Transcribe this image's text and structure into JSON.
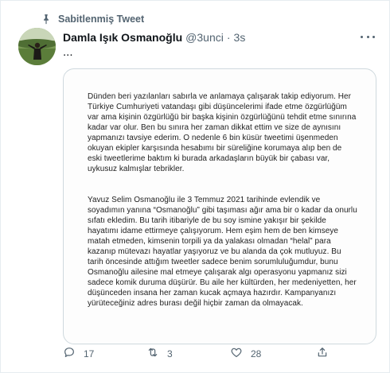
{
  "pinned": {
    "label": "Sabitlenmiş Tweet"
  },
  "author": {
    "name": "Damla Işık Osmanoğlu",
    "handle": "@3unci",
    "separator": "·",
    "time": "3s"
  },
  "tweet": {
    "text": "...",
    "image_paragraphs": [
      "Dünden beri yazılanları sabırla ve anlamaya çalışarak takip ediyorum. Her Türkiye Cumhuriyeti vatandaşı gibi düşüncelerimi ifade etme özgürlüğüm var ama kişinin özgürlüğü bir başka kişinin özgürlüğünü tehdit etme sınırına kadar var olur. Ben bu sınıra her zaman dikkat ettim ve size de aynısını yapmanızı tavsiye ederim. O nedenle 6 bin küsür tweetimi üşenmeden okuyan ekipler karşısında hesabımı bir süreliğine korumaya alıp ben de eski tweetlerime baktım ki burada arkadaşların büyük bir çabası var, uykusuz kalmışlar tebrikler.",
      "Yavuz Selim Osmanoğlu ile 3 Temmuz 2021 tarihinde evlendik ve soyadımın yanına “Osmanoğlu” gibi taşıması ağır ama bir o kadar da onurlu sıfatı ekledim. Bu tarih itibariyle de bu soy ismine yakışır bir şekilde hayatımı idame ettirmeye çalışıyorum. Hem eşim hem de ben kimseye matah etmeden, kimsenin torpili ya da yalakası olmadan “helal” para kazanıp mütevazı hayatlar yaşıyoruz ve bu alanda da çok mutluyuz. Bu tarih öncesinde attığım tweetler sadece benim sorumluluğumdur, bunu Osmanoğlu ailesine mal etmeye çalışarak algı operasyonu yapmanız sizi sadece komik duruma düşürür. Bu aile her kültürden, her medeniyetten, her düşünceden insana her zaman kucak açmaya hazırdır. Kampanyanızı yürüteceğiniz adres burası değil hiçbir zaman da olmayacak."
    ]
  },
  "actions": {
    "reply": {
      "icon": "reply-icon",
      "count": "17"
    },
    "retweet": {
      "icon": "retweet-icon",
      "count": "3"
    },
    "like": {
      "icon": "heart-icon",
      "count": "28"
    },
    "share": {
      "icon": "share-icon"
    }
  },
  "colors": {
    "muted": "#536471",
    "text": "#0f1419",
    "border": "#cfd9de"
  }
}
